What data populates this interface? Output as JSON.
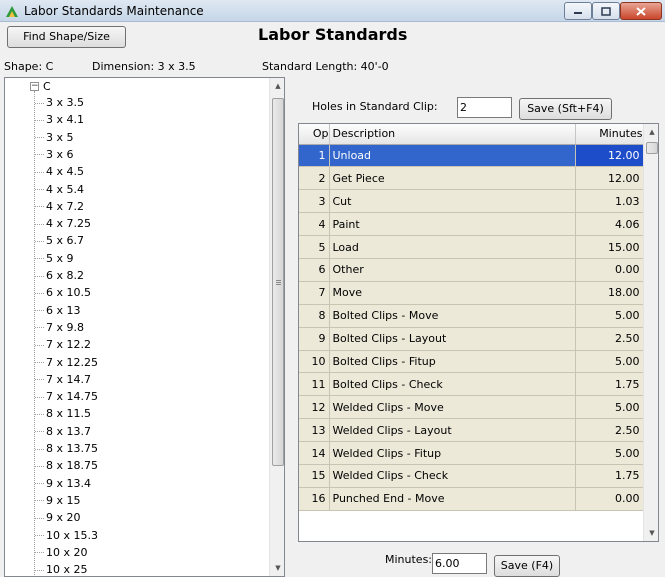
{
  "window": {
    "title": "Labor Standards Maintenance",
    "controls": {
      "minimize": "minimize-icon",
      "maximize": "maximize-icon",
      "close": "close-icon"
    }
  },
  "header": {
    "find_button": "Find Shape/Size",
    "title": "Labor Standards"
  },
  "info": {
    "shape": "Shape: C",
    "dimension": "Dimension: 3 x 3.5",
    "standard_length": "Standard Length: 40'-0"
  },
  "tree": {
    "root": "C",
    "items": [
      "3 x 3.5",
      "3 x 4.1",
      "3 x 5",
      "3 x 6",
      "4 x 4.5",
      "4 x 5.4",
      "4 x 7.2",
      "4 x 7.25",
      "5 x 6.7",
      "5 x 9",
      "6 x 8.2",
      "6 x 10.5",
      "6 x 13",
      "7 x 9.8",
      "7 x 12.2",
      "7 x 12.25",
      "7 x 14.7",
      "7 x 14.75",
      "8 x 11.5",
      "8 x 13.7",
      "8 x 13.75",
      "8 x 18.75",
      "9 x 13.4",
      "9 x 15",
      "9 x 20",
      "10 x 15.3",
      "10 x 20",
      "10 x 25"
    ]
  },
  "clip": {
    "label": "Holes in Standard Clip:",
    "value": "2",
    "save_label": "Save (Sft+F4)"
  },
  "grid": {
    "columns": [
      "Op",
      "Description",
      "Minutes"
    ],
    "rows": [
      {
        "op": "1",
        "desc": "Unload",
        "min": "12.00",
        "selected": true
      },
      {
        "op": "2",
        "desc": "Get Piece",
        "min": "12.00"
      },
      {
        "op": "3",
        "desc": "Cut",
        "min": "1.03"
      },
      {
        "op": "4",
        "desc": "Paint",
        "min": "4.06"
      },
      {
        "op": "5",
        "desc": "Load",
        "min": "15.00"
      },
      {
        "op": "6",
        "desc": "Other",
        "min": "0.00"
      },
      {
        "op": "7",
        "desc": "Move",
        "min": "18.00"
      },
      {
        "op": "8",
        "desc": "Bolted Clips - Move",
        "min": "5.00"
      },
      {
        "op": "9",
        "desc": "Bolted Clips - Layout",
        "min": "2.50"
      },
      {
        "op": "10",
        "desc": "Bolted Clips - Fitup",
        "min": "5.00"
      },
      {
        "op": "11",
        "desc": "Bolted Clips - Check",
        "min": "1.75"
      },
      {
        "op": "12",
        "desc": "Welded Clips - Move",
        "min": "5.00"
      },
      {
        "op": "13",
        "desc": "Welded Clips - Layout",
        "min": "2.50"
      },
      {
        "op": "14",
        "desc": "Welded Clips - Fitup",
        "min": "5.00"
      },
      {
        "op": "15",
        "desc": "Welded Clips - Check",
        "min": "1.75"
      },
      {
        "op": "16",
        "desc": "Punched End - Move",
        "min": "0.00"
      }
    ]
  },
  "footer": {
    "minutes_label": "Minutes:",
    "minutes_value": "6.00",
    "save_label": "Save (F4)"
  }
}
